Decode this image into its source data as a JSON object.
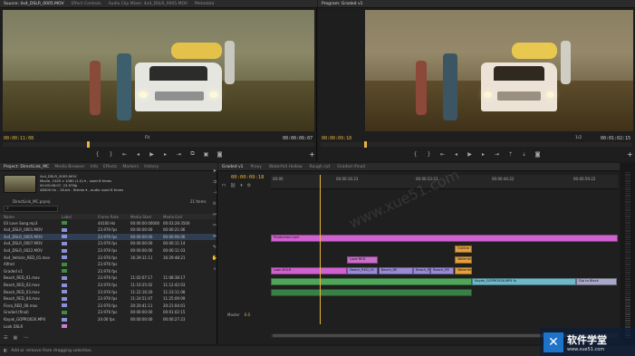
{
  "source_monitor": {
    "tabs": [
      "Source: 4x4_DSLR_0005.MOV",
      "Effect Controls",
      "Audio Clip Mixer: 4x4_DSLR_0005.MOV",
      "Metadata"
    ],
    "timecode_left": "00:00:11:08",
    "fit": "Fit",
    "timecode_right": "00:00:06:07",
    "playhead_pct": 0.27
  },
  "program_monitor": {
    "tabs": [
      "Program: Graded v1"
    ],
    "timecode_left": "00:00:09:18",
    "fit": "1/2",
    "timecode_right": "00:01:02:15",
    "playhead_pct": 0.14
  },
  "project_panel": {
    "tabs": [
      "Project: DirectLink_MC",
      "Media Browser",
      "Info",
      "Effects",
      "Markers",
      "History"
    ],
    "clip_info": [
      "4x4_DSLR_0005.MOV",
      "Movie, 1920 x 1080 (1.0) ▾ , used 6 times",
      "00:00:06:07, 23.976p",
      "48000 Hz - 16-bit - Stereo ▾ , audio used 6 times"
    ],
    "project_file": "DirectLink_MC.prproj",
    "item_count": "21 Items",
    "search_placeholder": "",
    "columns": [
      "Name",
      "Label",
      "Frame Rate",
      "Media Start",
      "Media End"
    ],
    "rows": [
      {
        "name": "03 Love Song.mp3",
        "color": "#3c8d3c",
        "fr": "44100 Hz",
        "ms": "00:00:00:00000",
        "me": "00:03:28:3500"
      },
      {
        "name": "4x4_DSLR_0001.MOV",
        "color": "#8a8fd8",
        "fr": "23.976 fps",
        "ms": "00:00:00:00",
        "me": "00:00:21:06"
      },
      {
        "name": "4x4_DSLR_0005.MOV",
        "color": "#8a8fd8",
        "fr": "23.976 fps",
        "ms": "00:00:00:00",
        "me": "00:00:06:06"
      },
      {
        "name": "4x4_DSLR_0007.MOV",
        "color": "#8a8fd8",
        "fr": "23.976 fps",
        "ms": "00:00:00:00",
        "me": "00:00:11:14"
      },
      {
        "name": "4x4_DSLR_0022.MOV",
        "color": "#8a8fd8",
        "fr": "23.976 fps",
        "ms": "00:00:00:00",
        "me": "00:00:11:03"
      },
      {
        "name": "4x4_Vehicle_RED_01.mov",
        "color": "#8a8fd8",
        "fr": "23.976 fps",
        "ms": "16:29:11:11",
        "me": "16:29:48:21"
      },
      {
        "name": "Alfred",
        "color": "#3c8d3c",
        "fr": "23.976 fps",
        "ms": "",
        "me": ""
      },
      {
        "name": "Graded v1",
        "color": "#3c8d3c",
        "fr": "23.976 fps",
        "ms": "",
        "me": ""
      },
      {
        "name": "Beach_RED_01.mov",
        "color": "#8a8fd8",
        "fr": "23.976 fps",
        "ms": "11:02:07:17",
        "me": "11:08:38:17"
      },
      {
        "name": "Beach_RED_02.mov",
        "color": "#8a8fd8",
        "fr": "23.976 fps",
        "ms": "11:10:25:02",
        "me": "11:12:42:03"
      },
      {
        "name": "Beach_RED_03.mov",
        "color": "#8a8fd8",
        "fr": "23.976 fps",
        "ms": "11:22:16:20",
        "me": "11:23:11:08"
      },
      {
        "name": "Beach_RED_04.mov",
        "color": "#8a8fd8",
        "fr": "23.976 fps",
        "ms": "11:24:51:07",
        "me": "11:25:09:09"
      },
      {
        "name": "Flora_RED_00.mov",
        "color": "#8a8fd8",
        "fr": "23.976 fps",
        "ms": "20:20:41:11",
        "me": "20:21:04:01"
      },
      {
        "name": "Graded (final)",
        "color": "#3c8d3c",
        "fr": "23.976 fps",
        "ms": "00:00:00:00",
        "me": "00:01:02:15"
      },
      {
        "name": "Kayak_GOPRO026.MP4",
        "color": "#8a8fd8",
        "fr": "24.00 fps",
        "ms": "00:00:00:00",
        "me": "00:00:27:23"
      },
      {
        "name": "Look DSLR",
        "color": "#d27ad2",
        "fr": "",
        "ms": "",
        "me": ""
      }
    ]
  },
  "timeline": {
    "tabs": [
      "Graded v1",
      "Proxy",
      "Waterfall Hollow",
      "Rough cut",
      "Graded (final)"
    ],
    "timecode": "00:00:09:18",
    "ruler_labels": [
      "00:00",
      "00:00:16:23",
      "00:00:33:23",
      "00:00:44:22",
      "00:00:59:22"
    ],
    "video_tracks": [
      "V8",
      "V7",
      "V6",
      "V5",
      "V4",
      "V3",
      "V2",
      "V1"
    ],
    "audio_tracks": [
      "A1",
      "A2",
      "A3"
    ],
    "master_label": "Master",
    "master_value": "0.0",
    "clips": [
      {
        "label": "Production Lock",
        "color": "#cf62cf",
        "track": 0,
        "start": 0.0,
        "end": 1.0
      },
      {
        "label": "Outline ?",
        "color": "#e2a040",
        "track": 1,
        "start": 0.53,
        "end": 0.58
      },
      {
        "label": "Look RED",
        "color": "#c96ec9",
        "track": 2,
        "start": 0.22,
        "end": 0.31
      },
      {
        "label": "Waterfall",
        "color": "#e2a040",
        "track": 2,
        "start": 0.53,
        "end": 0.58
      },
      {
        "label": "Look DSLR",
        "color": "#cf62cf",
        "track": 3,
        "start": 0.0,
        "end": 0.22
      },
      {
        "label": "Beach_RED_01",
        "color": "#9a8ad6",
        "track": 3,
        "start": 0.22,
        "end": 0.31
      },
      {
        "label": "Beach_RE",
        "color": "#9a8ad6",
        "track": 3,
        "start": 0.31,
        "end": 0.41
      },
      {
        "label": "Beach_RE",
        "color": "#9a8ad6",
        "track": 3,
        "start": 0.41,
        "end": 0.46
      },
      {
        "label": "Beach_RE",
        "color": "#9a8ad6",
        "track": 3,
        "start": 0.46,
        "end": 0.53
      },
      {
        "label": "Waterfall",
        "color": "#e2a040",
        "track": 3,
        "start": 0.53,
        "end": 0.58
      },
      {
        "label": "4x4_Vehic",
        "color": "#6fb8c8",
        "track": 4,
        "start": 0.0,
        "end": 0.08
      },
      {
        "label": "4x4_DSLR",
        "color": "#6fb8c8",
        "track": 4,
        "start": 0.08,
        "end": 0.16
      },
      {
        "label": "4x4_DSL",
        "color": "#6fb8c8",
        "track": 4,
        "start": 0.16,
        "end": 0.22
      },
      {
        "label": "Waterfall",
        "color": "#e2a040",
        "track": 4,
        "start": 0.53,
        "end": 0.58
      },
      {
        "label": "Kayak_GOPRO026.MP4 fx",
        "color": "#6fb8c8",
        "track": 4,
        "start": 0.58,
        "end": 0.88
      },
      {
        "label": "Dip to Black",
        "color": "#a8a8c8",
        "track": 4,
        "start": 0.88,
        "end": 1.0
      }
    ]
  },
  "status_bar": {
    "text": "Add or remove from dragging selection."
  },
  "watermark": {
    "brand": "软件学堂",
    "url": "www.xue51.com",
    "overlay_text": "www.xue51.com"
  }
}
